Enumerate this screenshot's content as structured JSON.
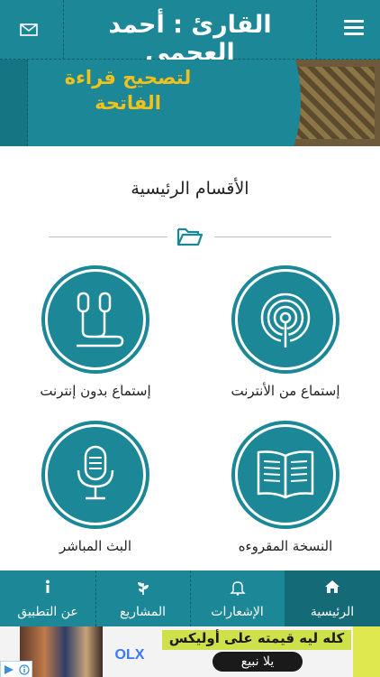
{
  "header": {
    "title": "القارئ : أحمد العجمي",
    "menu_icon": "hamburger-icon",
    "mail_icon": "envelope-icon",
    "bg_color": "#1c8796"
  },
  "banner": {
    "line1": "لتصحيح قراءة",
    "line2": "الفاتحة",
    "text_color": "#f1c21b"
  },
  "main": {
    "section_title": "الأقسام الرئيسية",
    "divider_icon": "folder-open-icon",
    "items": [
      {
        "label": "إستماع من الأنترنت",
        "icon": "broadcast-icon"
      },
      {
        "label": "إستماع بدون إنترنت",
        "icon": "earphones-icon"
      },
      {
        "label": "النسخة المقروءه",
        "icon": "open-book-icon"
      },
      {
        "label": "البث المباشر",
        "icon": "microphone-icon"
      }
    ]
  },
  "tabs": [
    {
      "label": "الرئيسية",
      "icon": "home-icon",
      "active": true
    },
    {
      "label": "الإشعارات",
      "icon": "bell-icon",
      "active": false
    },
    {
      "label": "المشاريع",
      "icon": "plant-icon",
      "active": false
    },
    {
      "label": "عن التطبيق",
      "icon": "info-icon",
      "active": false
    }
  ],
  "ad": {
    "brand": "OLX",
    "line1": "كله ليه قيمته على أوليكس",
    "line2": "يلا نبيع"
  }
}
